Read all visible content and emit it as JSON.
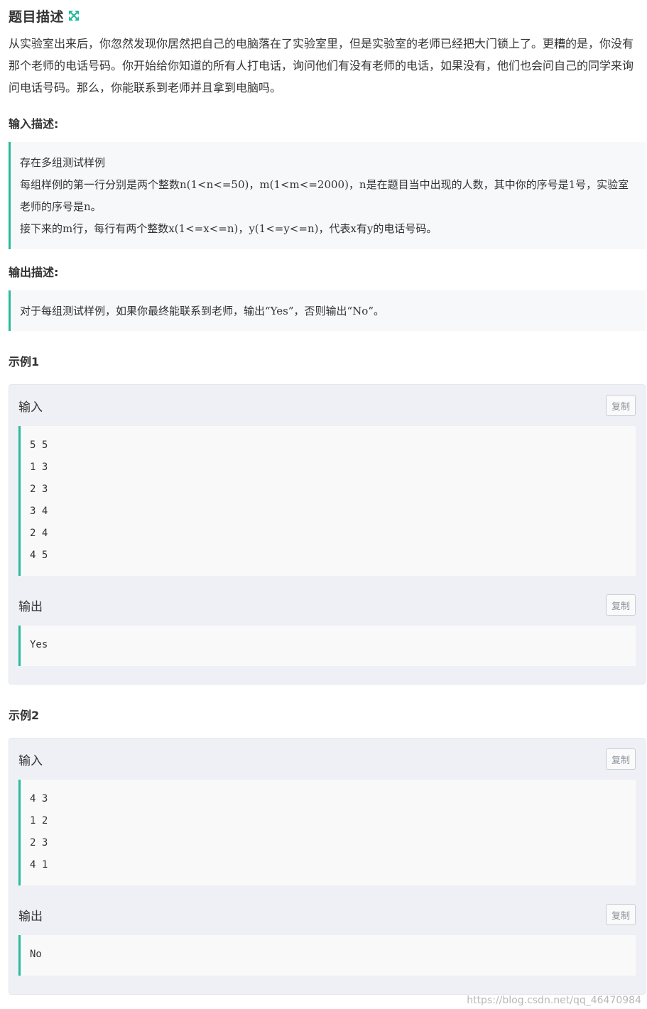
{
  "header": {
    "title": "题目描述",
    "expand_icon": "expand-arrows-icon",
    "accent_color": "#25bb9b"
  },
  "description": "从实验室出来后，你忽然发现你居然把自己的电脑落在了实验室里，但是实验室的老师已经把大门锁上了。更糟的是，你没有那个老师的电话号码。你开始给你知道的所有人打电话，询问他们有没有老师的电话，如果没有，他们也会问自己的同学来询问电话号码。那么，你能联系到老师并且拿到电脑吗。",
  "input_section": {
    "heading": "输入描述:",
    "lines": [
      "存在多组测试样例",
      "每组样例的第一行分别是两个整数n(1<n<=50)，m(1<m<=2000)，n是在题目当中出现的人数，其中你的序号是1号，实验室老师的序号是n。",
      "接下来的m行，每行有两个整数x(1<=x<=n)，y(1<=y<=n)，代表x有y的电话号码。"
    ]
  },
  "output_section": {
    "heading": "输出描述:",
    "lines": [
      "对于每组测试样例，如果你最终能联系到老师，输出“Yes”，否则输出“No”。"
    ]
  },
  "examples": [
    {
      "heading": "示例1",
      "input_label": "输入",
      "input_lines": [
        "5 5",
        "1 3",
        "2 3",
        "3 4",
        "2 4",
        "4 5"
      ],
      "output_label": "输出",
      "output_lines": [
        "Yes"
      ],
      "copy_label": "复制"
    },
    {
      "heading": "示例2",
      "input_label": "输入",
      "input_lines": [
        "4 3",
        "1 2",
        "2 3",
        "4 1"
      ],
      "output_label": "输出",
      "output_lines": [
        "No"
      ],
      "copy_label": "复制"
    }
  ],
  "watermark": "https://blog.csdn.net/qq_46470984"
}
